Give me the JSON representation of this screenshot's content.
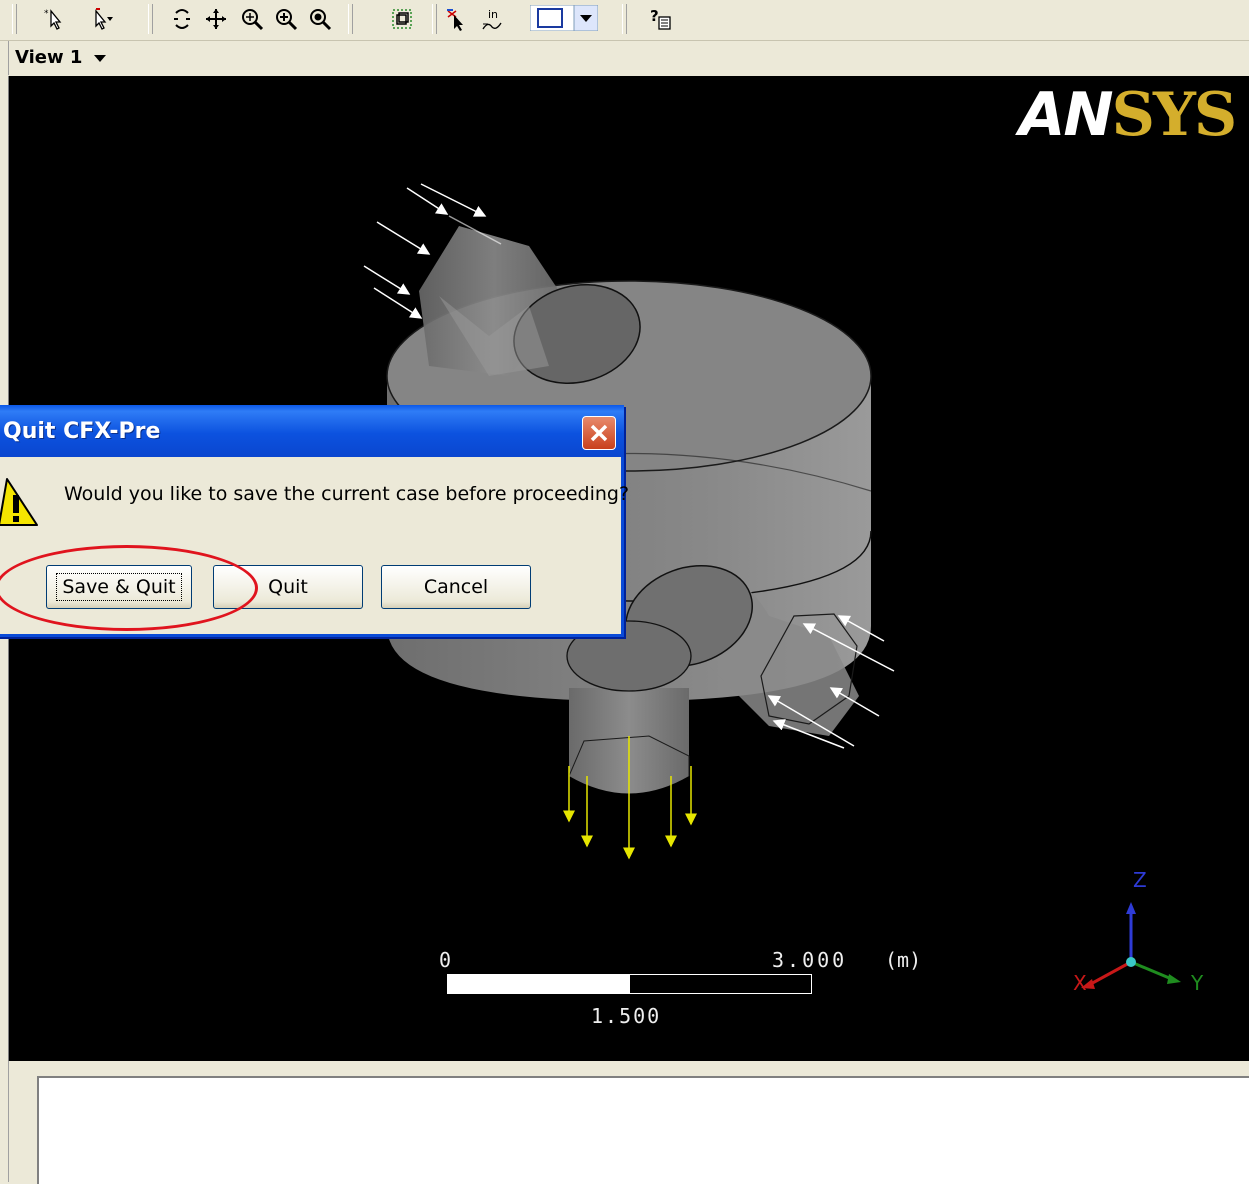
{
  "toolbar": {
    "icons": [
      "select-icon",
      "select-dropdown-icon",
      "rotate-icon",
      "pan-icon",
      "zoom-icon",
      "zoom-box-icon",
      "zoom-fit-icon",
      "fit-view-icon",
      "pick-icon",
      "mesh-icon",
      "view-mode-select",
      "help-icon"
    ]
  },
  "view": {
    "label": "View 1"
  },
  "viewport": {
    "logo_white": "AN",
    "logo_gold": "SYS",
    "scale": {
      "zero": "0",
      "max": "3.000",
      "unit": "(m)",
      "mid": "1.500"
    },
    "axes": {
      "z": "Z",
      "x": "X",
      "y": "Y"
    },
    "colors": {
      "background": "#000000",
      "logo_gold": "#d4ae2c",
      "inlet_arrows": "#ffffff",
      "outlet_arrows": "#e6e600"
    }
  },
  "dialog": {
    "title": "Quit CFX-Pre",
    "message": "Would you like to save the current case before proceeding?",
    "buttons": {
      "save_quit": "Save & Quit",
      "quit": "Quit",
      "cancel": "Cancel"
    },
    "highlight_color": "#e0141e"
  }
}
